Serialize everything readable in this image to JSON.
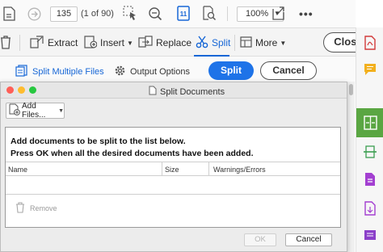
{
  "nav": {
    "page_input": "135",
    "page_of": "(1 of 90)",
    "zoom": "100%"
  },
  "toolbar": {
    "extract": "Extract",
    "insert": "Insert",
    "replace": "Replace",
    "split": "Split",
    "more": "More",
    "close": "Close"
  },
  "secondary": {
    "split_multiple": "Split Multiple Files",
    "output_options": "Output Options",
    "split_button": "Split",
    "cancel_button": "Cancel"
  },
  "dialog": {
    "title": "Split Documents",
    "add_files": "Add Files...",
    "instruction_line1": "Add documents to be split to the list below.",
    "instruction_line2": "Press OK when all the desired documents have been added.",
    "columns": [
      "Name",
      "Size",
      "Warnings/Errors"
    ],
    "remove": "Remove",
    "ok": "OK",
    "cancel": "Cancel"
  },
  "colors": {
    "accent": "#1666d6",
    "split_button": "#1e73e8",
    "rail_active": "#5aa642"
  },
  "icons": [
    "save-icon",
    "up-arrow-icon",
    "down-arrow-icon",
    "select-icon",
    "zoom-out-icon",
    "fit-page-icon",
    "zoom-tool-icon",
    "share-icon",
    "more-icon",
    "delete-icon",
    "extract-icon",
    "insert-icon",
    "replace-icon",
    "scissors-icon",
    "more-tools-icon",
    "split-multiple-icon",
    "gear-icon",
    "document-icon",
    "add-file-icon",
    "trash-icon"
  ]
}
